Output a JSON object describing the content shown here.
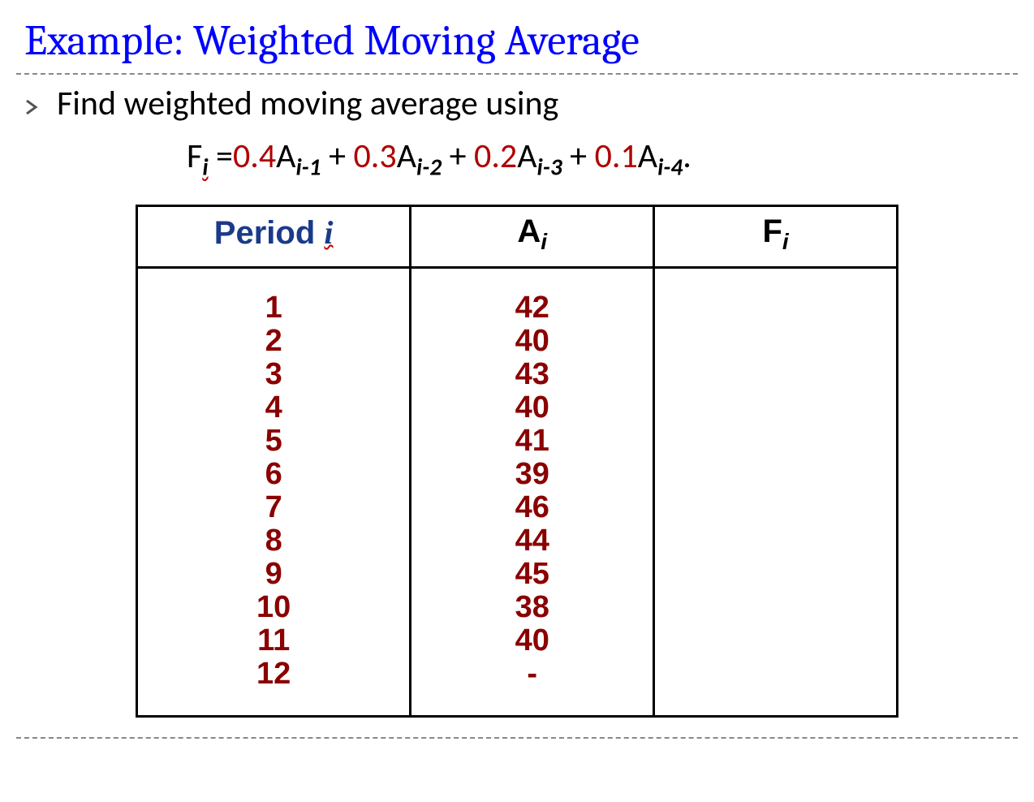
{
  "title": "Example: Weighted Moving Average",
  "bullet_text": "Find weighted moving average using",
  "formula": {
    "F": "F",
    "eq": " =",
    "parts": [
      {
        "coef": "0.4",
        "A": "A",
        "sub": "i-1"
      },
      {
        "coef": "0.3",
        "A": "A",
        "sub": "i-2"
      },
      {
        "coef": "0.2",
        "A": "A",
        "sub": "i-3"
      },
      {
        "coef": "0.1",
        "A": "A",
        "sub": "i-4"
      }
    ],
    "plus": " + ",
    "period": "."
  },
  "table": {
    "headers": {
      "period": "Period ",
      "period_i": "i",
      "A": "A",
      "F": "F",
      "i": "i"
    },
    "periods": [
      "1",
      "2",
      "3",
      "4",
      "5",
      "6",
      "7",
      "8",
      "9",
      "10",
      "11",
      "12"
    ],
    "A": [
      "42",
      "40",
      "43",
      "40",
      "41",
      "39",
      "46",
      "44",
      "45",
      "38",
      "40",
      "-"
    ],
    "F": [
      "",
      "",
      "",
      "",
      "",
      "",
      "",
      "",
      "",
      "",
      "",
      ""
    ]
  },
  "chart_data": {
    "type": "table",
    "title": "Weighted Moving Average Data",
    "columns": [
      "Period i",
      "A_i",
      "F_i"
    ],
    "rows": [
      [
        1,
        42,
        null
      ],
      [
        2,
        40,
        null
      ],
      [
        3,
        43,
        null
      ],
      [
        4,
        40,
        null
      ],
      [
        5,
        41,
        null
      ],
      [
        6,
        39,
        null
      ],
      [
        7,
        46,
        null
      ],
      [
        8,
        44,
        null
      ],
      [
        9,
        45,
        null
      ],
      [
        10,
        38,
        null
      ],
      [
        11,
        40,
        null
      ],
      [
        12,
        null,
        null
      ]
    ],
    "formula": "F_i = 0.4*A_{i-1} + 0.3*A_{i-2} + 0.2*A_{i-3} + 0.1*A_{i-4}"
  }
}
